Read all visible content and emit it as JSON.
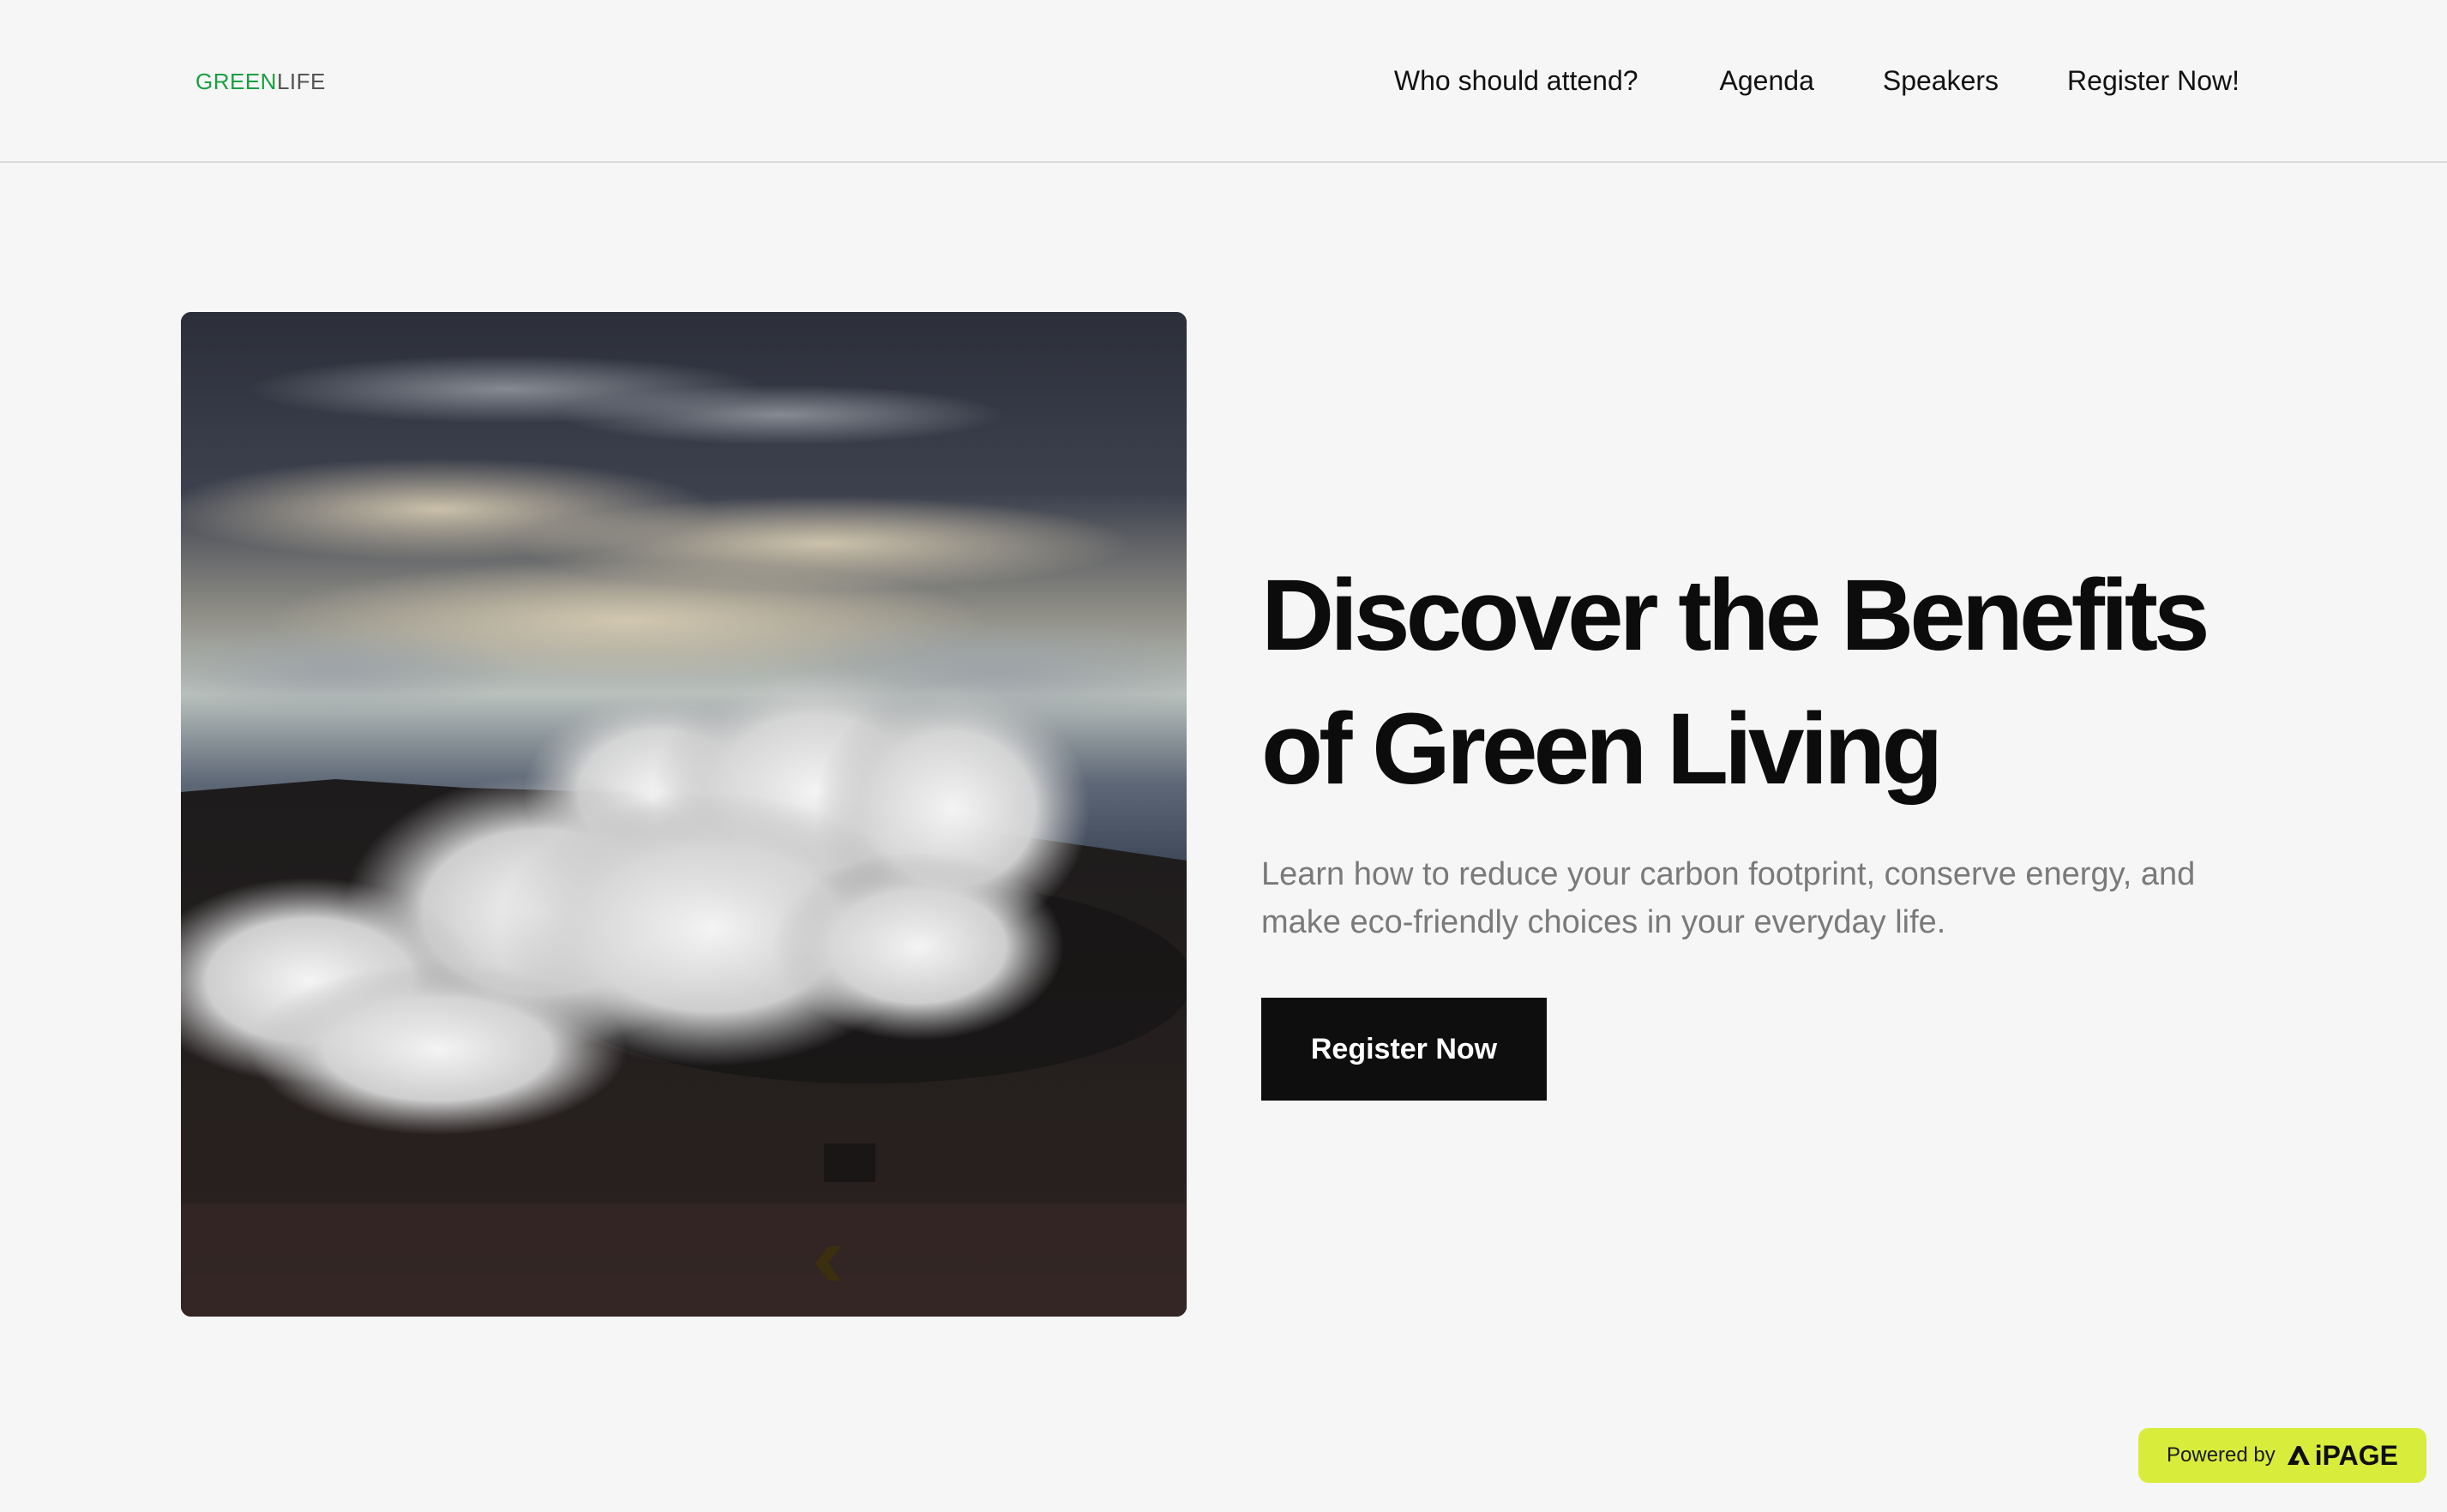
{
  "header": {
    "logo": {
      "part1": "GREEN",
      "part2": "LIFE"
    },
    "nav": [
      {
        "label": "Who should attend?"
      },
      {
        "label": "Agenda"
      },
      {
        "label": "Speakers"
      },
      {
        "label": "Register Now!"
      }
    ]
  },
  "hero": {
    "title": "Discover the Benefits of Green Living",
    "subtitle": "Learn how to reduce your carbon footprint, conserve energy, and make eco-friendly choices in your everyday life.",
    "cta_label": "Register Now",
    "image_icon": "landscape-steam-photo"
  },
  "footer_badge": {
    "powered_by": "Powered by",
    "brand": "iPAGE",
    "icon": "aipage-logo-icon"
  },
  "colors": {
    "logo_green": "#19a043",
    "cta_background": "#0e0e0e",
    "badge_background": "#d8ec3c",
    "page_background": "#f7f6f6"
  }
}
